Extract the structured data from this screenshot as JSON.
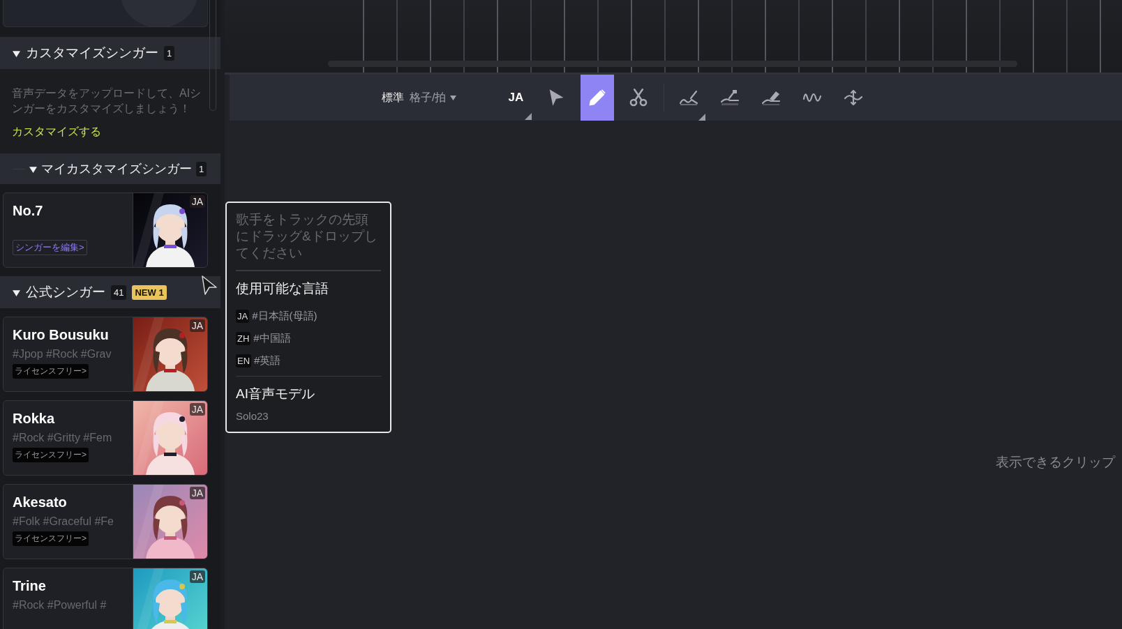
{
  "sidebar": {
    "custom_section": {
      "title": "カスタマイズシンガー",
      "count": "1",
      "expanded": true,
      "description": "音声データをアップロードして、AIシンガーをカスタマイズしましょう！",
      "link": "カスタマイズする"
    },
    "my_section": {
      "title": "マイカスタマイズシンガー",
      "count": "1",
      "expanded": true,
      "singers": [
        {
          "name": "No.7",
          "language": "JA",
          "action": "シンガーを編集>"
        }
      ]
    },
    "official_section": {
      "title": "公式シンガー",
      "count": "41",
      "badge": "NEW 1",
      "expanded": true,
      "singers": [
        {
          "name": "Kuro Bousuku",
          "tags": "#Jpop #Rock #Grav",
          "license": "ライセンスフリー>",
          "language": "JA"
        },
        {
          "name": "Rokka",
          "tags": "#Rock #Gritty #Fem",
          "license": "ライセンスフリー>",
          "language": "JA"
        },
        {
          "name": "Akesato",
          "tags": "#Folk #Graceful #Fe",
          "license": "ライセンスフリー>",
          "language": "JA"
        },
        {
          "name": "Trine",
          "tags": "#Rock #Powerful #",
          "language": "JA"
        }
      ]
    }
  },
  "toolbar": {
    "mode": "標準",
    "grid": "格子/拍",
    "language": "JA",
    "tools": [
      {
        "kind": "select",
        "selected": false,
        "menu": false
      },
      {
        "kind": "pencil",
        "selected": true,
        "menu": false
      },
      {
        "kind": "scissors",
        "selected": false,
        "menu": false
      }
    ],
    "curve_tools": [
      {
        "kind": "curve-pen",
        "selected": false,
        "menu": true
      },
      {
        "kind": "curve-brush",
        "selected": false,
        "menu": false
      },
      {
        "kind": "curve-eraser",
        "selected": false,
        "menu": false
      },
      {
        "kind": "wave",
        "selected": false,
        "menu": false
      },
      {
        "kind": "vibrato",
        "selected": false,
        "menu": false
      }
    ]
  },
  "tooltip": {
    "hint": "歌手をトラックの先頭にドラッグ&ドロップしてください",
    "languages_title": "使用可能な言語",
    "languages": [
      {
        "code": "JA",
        "label": "#日本語(母語)"
      },
      {
        "code": "ZH",
        "label": "#中国語"
      },
      {
        "code": "EN",
        "label": "#英語"
      }
    ],
    "model_title": "AI音声モデル",
    "model": "Solo23"
  },
  "empty_message": "表示できるクリップ"
}
